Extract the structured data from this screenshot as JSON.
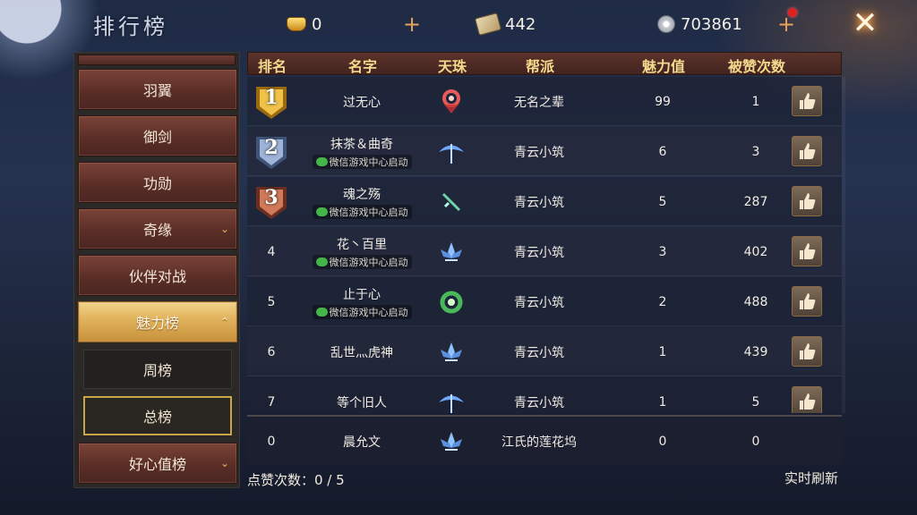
{
  "title": "排行榜",
  "currencies": {
    "gold": {
      "value": "0",
      "icon": "gold-ingot-icon"
    },
    "token": {
      "value": "442",
      "icon": "scroll-token-icon"
    },
    "silver": {
      "value": "703861",
      "icon": "silver-coin-icon"
    }
  },
  "plus_glyph": "+",
  "close_glyph": "✕",
  "menu": {
    "items": [
      {
        "label": "羽翼"
      },
      {
        "label": "御剑"
      },
      {
        "label": "功勋"
      },
      {
        "label": "奇缘",
        "chevron": "⌄"
      },
      {
        "label": "伙伴对战"
      },
      {
        "label": "魅力榜",
        "chevron": "⌃",
        "active": true
      },
      {
        "label": "好心值榜",
        "chevron": "⌄"
      }
    ],
    "sub_items": [
      {
        "label": "周榜"
      },
      {
        "label": "总榜",
        "selected": true
      }
    ]
  },
  "table": {
    "headers": [
      "排名",
      "名字",
      "天珠",
      "帮派",
      "魅力值",
      "被赞次数"
    ],
    "wechat_tag": "微信游戏中心启动",
    "rows": [
      {
        "rank": "1",
        "name": "过无心",
        "pearl": "red-ring-pearl",
        "guild": "无名之辈",
        "charm": "99",
        "likes": "1",
        "wechat": false,
        "medal": "gold"
      },
      {
        "rank": "2",
        "name": "抹茶＆曲奇",
        "pearl": "blue-umbrella-pearl",
        "guild": "青云小筑",
        "charm": "6",
        "likes": "3",
        "wechat": true,
        "medal": "silver"
      },
      {
        "rank": "3",
        "name": "魂之殇",
        "pearl": "green-sword-pearl",
        "guild": "青云小筑",
        "charm": "5",
        "likes": "287",
        "wechat": true,
        "medal": "bronze"
      },
      {
        "rank": "4",
        "name": "花丶百里",
        "pearl": "blue-lotus-pearl",
        "guild": "青云小筑",
        "charm": "3",
        "likes": "402",
        "wechat": true
      },
      {
        "rank": "5",
        "name": "止于心",
        "pearl": "green-wreath-pearl",
        "guild": "青云小筑",
        "charm": "2",
        "likes": "488",
        "wechat": true
      },
      {
        "rank": "6",
        "name": "乱世灬虎神",
        "pearl": "blue-lotus-pearl",
        "guild": "青云小筑",
        "charm": "1",
        "likes": "439",
        "wechat": false
      },
      {
        "rank": "7",
        "name": "等个旧人",
        "pearl": "blue-umbrella-pearl",
        "guild": "青云小筑",
        "charm": "1",
        "likes": "5",
        "wechat": false
      }
    ],
    "self_row": {
      "rank": "0",
      "name": "晨允文",
      "pearl": "blue-lotus-pearl",
      "guild": "江氏的莲花坞",
      "charm": "0",
      "likes": "0"
    }
  },
  "footer": {
    "like_count_text": "点赞次数：0 / 5",
    "refresh_label": "实时刷新"
  },
  "colors": {
    "header_text": "#f5d98c",
    "active_tab": "#e2b45e",
    "menu_item": "#6a3a31",
    "red_dot": "#e02020"
  }
}
